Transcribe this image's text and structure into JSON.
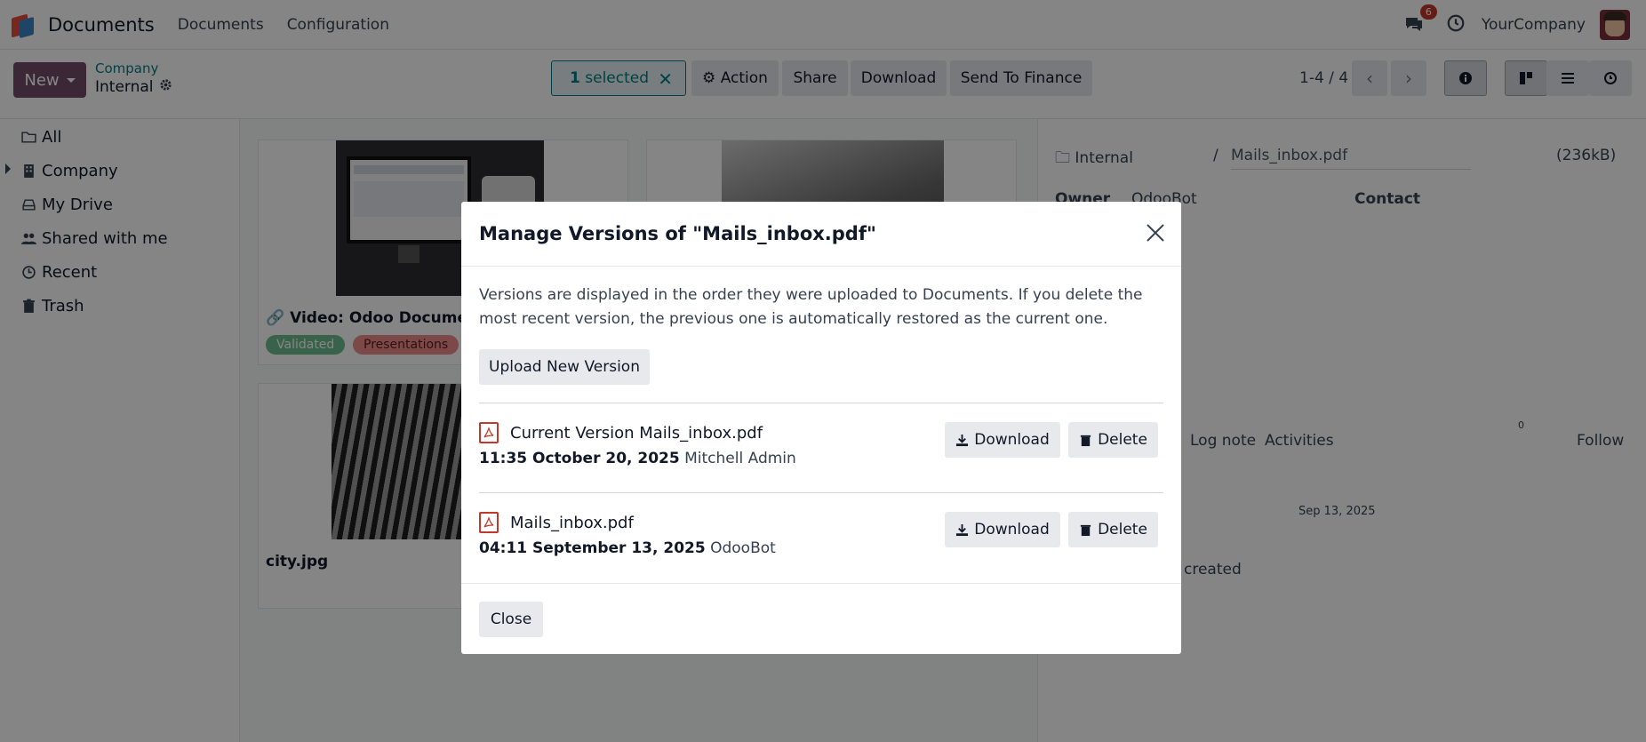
{
  "navbar": {
    "app_name": "Documents",
    "menu": [
      "Documents",
      "Configuration"
    ],
    "chat_badge": "6",
    "company": "YourCompany"
  },
  "control": {
    "new_label": "New",
    "breadcrumb_parent": "Company",
    "breadcrumb_current": "Internal",
    "selected_count": "1",
    "selected_label": "selected",
    "action_label": "Action",
    "share_label": "Share",
    "download_label": "Download",
    "finance_label": "Send To Finance",
    "pager": "1-4 / 4"
  },
  "sidebar": {
    "items": [
      {
        "label": "All",
        "icon": "folder-icon"
      },
      {
        "label": "Company",
        "icon": "building-icon"
      },
      {
        "label": "My Drive",
        "icon": "drive-icon"
      },
      {
        "label": "Shared with me",
        "icon": "users-icon"
      },
      {
        "label": "Recent",
        "icon": "clock-icon"
      },
      {
        "label": "Trash",
        "icon": "trash-icon"
      }
    ]
  },
  "kanban": {
    "cards": [
      {
        "title": "Video: Odoo Documents",
        "tags": [
          "Validated",
          "Presentations"
        ]
      },
      {
        "title": "",
        "tags": []
      },
      {
        "title": "city.jpg",
        "tags": []
      }
    ]
  },
  "preview": {
    "folder": "Internal",
    "slash": "/",
    "filename": "Mails_inbox.pdf",
    "size": "(236kB)",
    "owner_label": "Owner",
    "owner_value": "OdooBot",
    "contact_label": "Contact",
    "log_note": "Log note",
    "activities": "Activities",
    "followers_count": "0",
    "follow": "Follow",
    "date_sep": "Sep 13, 2025",
    "activity_text": "created"
  },
  "modal": {
    "title": "Manage Versions of \"Mails_inbox.pdf\"",
    "description": "Versions are displayed in the order they were uploaded to Documents. If you delete the most recent version, the previous one is automatically restored as the current one.",
    "upload_label": "Upload New Version",
    "versions": [
      {
        "name": "Current Version Mails_inbox.pdf",
        "datetime": "11:35 October 20, 2025",
        "author": "Mitchell Admin",
        "download": "Download",
        "delete": "Delete"
      },
      {
        "name": "Mails_inbox.pdf",
        "datetime": "04:11 September 13, 2025",
        "author": "OdooBot",
        "download": "Download",
        "delete": "Delete"
      }
    ],
    "close_label": "Close"
  },
  "colors": {
    "brand": "#714b67",
    "teal": "#017e84",
    "validated_tag": "#6bbf8e",
    "presentations_tag": "#f08a8a"
  }
}
